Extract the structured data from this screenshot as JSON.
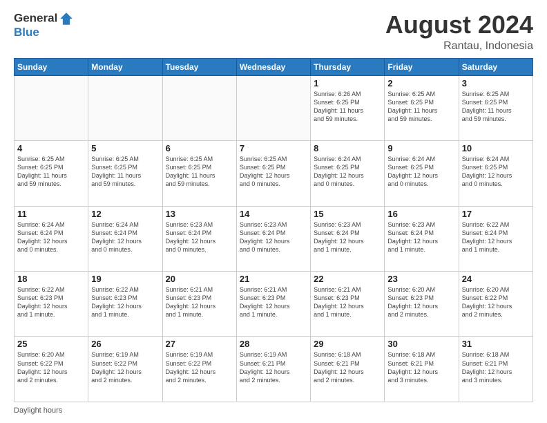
{
  "header": {
    "logo_line1": "General",
    "logo_line2": "Blue",
    "month_year": "August 2024",
    "location": "Rantau, Indonesia"
  },
  "days_of_week": [
    "Sunday",
    "Monday",
    "Tuesday",
    "Wednesday",
    "Thursday",
    "Friday",
    "Saturday"
  ],
  "weeks": [
    [
      {
        "day": "",
        "info": ""
      },
      {
        "day": "",
        "info": ""
      },
      {
        "day": "",
        "info": ""
      },
      {
        "day": "",
        "info": ""
      },
      {
        "day": "1",
        "info": "Sunrise: 6:26 AM\nSunset: 6:25 PM\nDaylight: 11 hours\nand 59 minutes."
      },
      {
        "day": "2",
        "info": "Sunrise: 6:25 AM\nSunset: 6:25 PM\nDaylight: 11 hours\nand 59 minutes."
      },
      {
        "day": "3",
        "info": "Sunrise: 6:25 AM\nSunset: 6:25 PM\nDaylight: 11 hours\nand 59 minutes."
      }
    ],
    [
      {
        "day": "4",
        "info": "Sunrise: 6:25 AM\nSunset: 6:25 PM\nDaylight: 11 hours\nand 59 minutes."
      },
      {
        "day": "5",
        "info": "Sunrise: 6:25 AM\nSunset: 6:25 PM\nDaylight: 11 hours\nand 59 minutes."
      },
      {
        "day": "6",
        "info": "Sunrise: 6:25 AM\nSunset: 6:25 PM\nDaylight: 11 hours\nand 59 minutes."
      },
      {
        "day": "7",
        "info": "Sunrise: 6:25 AM\nSunset: 6:25 PM\nDaylight: 12 hours\nand 0 minutes."
      },
      {
        "day": "8",
        "info": "Sunrise: 6:24 AM\nSunset: 6:25 PM\nDaylight: 12 hours\nand 0 minutes."
      },
      {
        "day": "9",
        "info": "Sunrise: 6:24 AM\nSunset: 6:25 PM\nDaylight: 12 hours\nand 0 minutes."
      },
      {
        "day": "10",
        "info": "Sunrise: 6:24 AM\nSunset: 6:25 PM\nDaylight: 12 hours\nand 0 minutes."
      }
    ],
    [
      {
        "day": "11",
        "info": "Sunrise: 6:24 AM\nSunset: 6:24 PM\nDaylight: 12 hours\nand 0 minutes."
      },
      {
        "day": "12",
        "info": "Sunrise: 6:24 AM\nSunset: 6:24 PM\nDaylight: 12 hours\nand 0 minutes."
      },
      {
        "day": "13",
        "info": "Sunrise: 6:23 AM\nSunset: 6:24 PM\nDaylight: 12 hours\nand 0 minutes."
      },
      {
        "day": "14",
        "info": "Sunrise: 6:23 AM\nSunset: 6:24 PM\nDaylight: 12 hours\nand 0 minutes."
      },
      {
        "day": "15",
        "info": "Sunrise: 6:23 AM\nSunset: 6:24 PM\nDaylight: 12 hours\nand 1 minute."
      },
      {
        "day": "16",
        "info": "Sunrise: 6:23 AM\nSunset: 6:24 PM\nDaylight: 12 hours\nand 1 minute."
      },
      {
        "day": "17",
        "info": "Sunrise: 6:22 AM\nSunset: 6:24 PM\nDaylight: 12 hours\nand 1 minute."
      }
    ],
    [
      {
        "day": "18",
        "info": "Sunrise: 6:22 AM\nSunset: 6:23 PM\nDaylight: 12 hours\nand 1 minute."
      },
      {
        "day": "19",
        "info": "Sunrise: 6:22 AM\nSunset: 6:23 PM\nDaylight: 12 hours\nand 1 minute."
      },
      {
        "day": "20",
        "info": "Sunrise: 6:21 AM\nSunset: 6:23 PM\nDaylight: 12 hours\nand 1 minute."
      },
      {
        "day": "21",
        "info": "Sunrise: 6:21 AM\nSunset: 6:23 PM\nDaylight: 12 hours\nand 1 minute."
      },
      {
        "day": "22",
        "info": "Sunrise: 6:21 AM\nSunset: 6:23 PM\nDaylight: 12 hours\nand 1 minute."
      },
      {
        "day": "23",
        "info": "Sunrise: 6:20 AM\nSunset: 6:23 PM\nDaylight: 12 hours\nand 2 minutes."
      },
      {
        "day": "24",
        "info": "Sunrise: 6:20 AM\nSunset: 6:22 PM\nDaylight: 12 hours\nand 2 minutes."
      }
    ],
    [
      {
        "day": "25",
        "info": "Sunrise: 6:20 AM\nSunset: 6:22 PM\nDaylight: 12 hours\nand 2 minutes."
      },
      {
        "day": "26",
        "info": "Sunrise: 6:19 AM\nSunset: 6:22 PM\nDaylight: 12 hours\nand 2 minutes."
      },
      {
        "day": "27",
        "info": "Sunrise: 6:19 AM\nSunset: 6:22 PM\nDaylight: 12 hours\nand 2 minutes."
      },
      {
        "day": "28",
        "info": "Sunrise: 6:19 AM\nSunset: 6:21 PM\nDaylight: 12 hours\nand 2 minutes."
      },
      {
        "day": "29",
        "info": "Sunrise: 6:18 AM\nSunset: 6:21 PM\nDaylight: 12 hours\nand 2 minutes."
      },
      {
        "day": "30",
        "info": "Sunrise: 6:18 AM\nSunset: 6:21 PM\nDaylight: 12 hours\nand 3 minutes."
      },
      {
        "day": "31",
        "info": "Sunrise: 6:18 AM\nSunset: 6:21 PM\nDaylight: 12 hours\nand 3 minutes."
      }
    ]
  ],
  "footer": {
    "daylight_label": "Daylight hours"
  }
}
